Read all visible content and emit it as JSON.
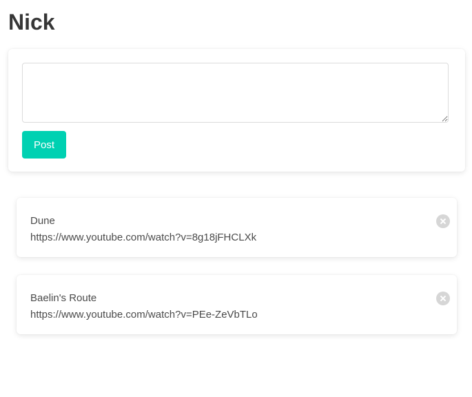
{
  "page": {
    "title": "Nick"
  },
  "composer": {
    "textarea_value": "",
    "textarea_placeholder": "",
    "post_label": "Post",
    "accent_color": "#00d1b2"
  },
  "posts": [
    {
      "title": "Dune",
      "url": "https://www.youtube.com/watch?v=8g18jFHCLXk",
      "delete_icon": "close-circle-icon"
    },
    {
      "title": "Baelin's Route",
      "url": "https://www.youtube.com/watch?v=PEe-ZeVbTLo",
      "delete_icon": "close-circle-icon"
    }
  ]
}
